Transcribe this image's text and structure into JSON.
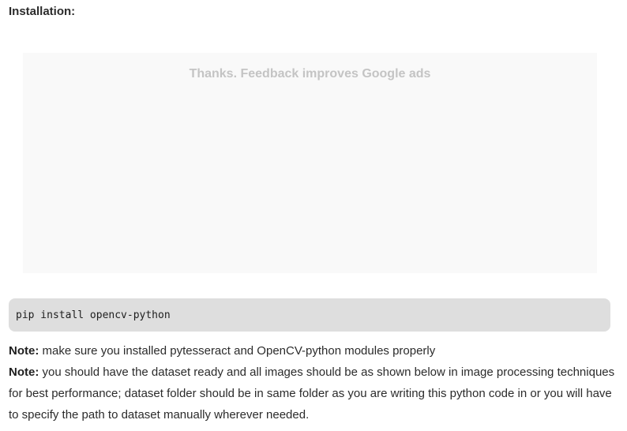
{
  "section": {
    "heading": "Installation:"
  },
  "ad": {
    "feedback_text": "Thanks. Feedback improves Google ads"
  },
  "code": {
    "command": "pip install opencv-python"
  },
  "notes": [
    {
      "label": "Note:",
      "text": " make sure you installed pytesseract and OpenCV-python modules properly"
    },
    {
      "label": "Note:",
      "text": " you should have the dataset ready and all images should be as shown below in image processing techniques for best performance; dataset folder should be in same folder as you are writing this python code in or you will have to specify the path to dataset manually wherever needed."
    }
  ]
}
